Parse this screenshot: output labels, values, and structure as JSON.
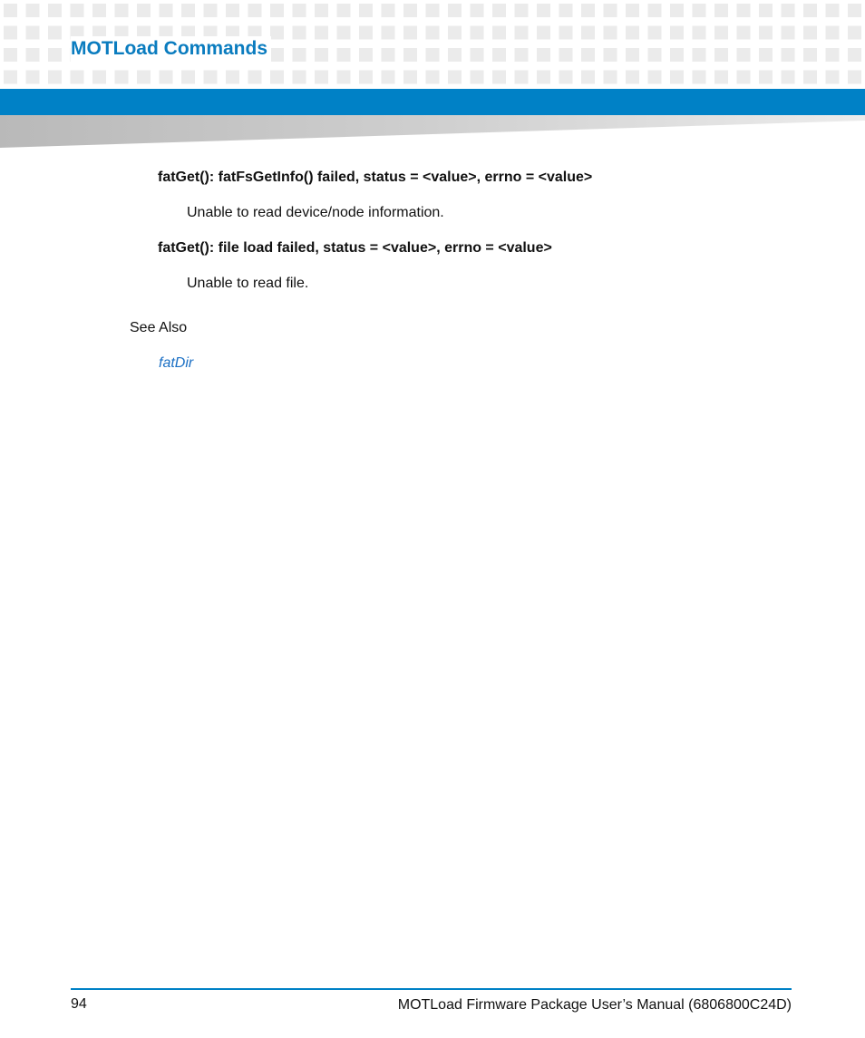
{
  "header": {
    "title": "MOTLoad Commands"
  },
  "messages": [
    {
      "heading": "fatGet(): fatFsGetInfo() failed, status = <value>, errno = <value>",
      "description": "Unable to read device/node information."
    },
    {
      "heading": "fatGet(): file load failed, status = <value>, errno = <value>",
      "description": "Unable to read file."
    }
  ],
  "see_also": {
    "label": "See Also",
    "link": "fatDir"
  },
  "footer": {
    "page_number": "94",
    "document_title": "MOTLoad Firmware Package User’s Manual (6806800C24D)"
  },
  "colors": {
    "brand_blue": "#0081c6",
    "title_blue": "#0a7cbf",
    "link_blue": "#1a6fc4"
  }
}
